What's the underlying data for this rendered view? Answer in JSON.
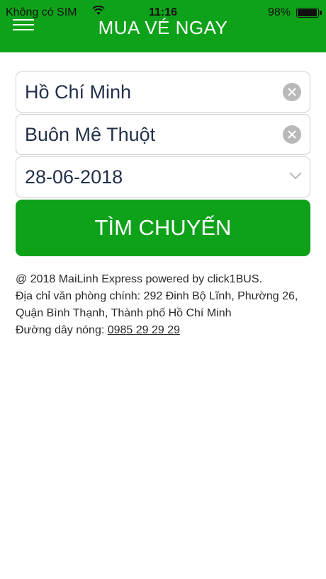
{
  "status_bar": {
    "carrier": "Không có SIM",
    "time": "11:16",
    "battery": "98%",
    "battery_level": 0.98
  },
  "header": {
    "title": "MUA VÉ NGAY",
    "menu_icon": "hamburger-menu-icon",
    "color": "#0ea21a"
  },
  "form": {
    "origin": {
      "value": "Hồ Chí Minh",
      "icon": "clear-icon"
    },
    "destination": {
      "value": "Buôn Mê Thuột",
      "icon": "clear-icon"
    },
    "date": {
      "value": "28-06-2018",
      "icon": "chevron-down-icon"
    },
    "search_label": "TÌM CHUYẾN"
  },
  "footer": {
    "line1": "@ 2018 MaiLinh Express powered by click1BUS.",
    "line2": "Địa chỉ văn phòng chính: 292 Đinh Bộ Lĩnh, Phường 26,",
    "line3": "Quận Bình Thạnh, Thành phố Hồ Chí Minh",
    "hotline_label": "Đường dây nóng: ",
    "hotline_number": "0985 29 29 29"
  }
}
